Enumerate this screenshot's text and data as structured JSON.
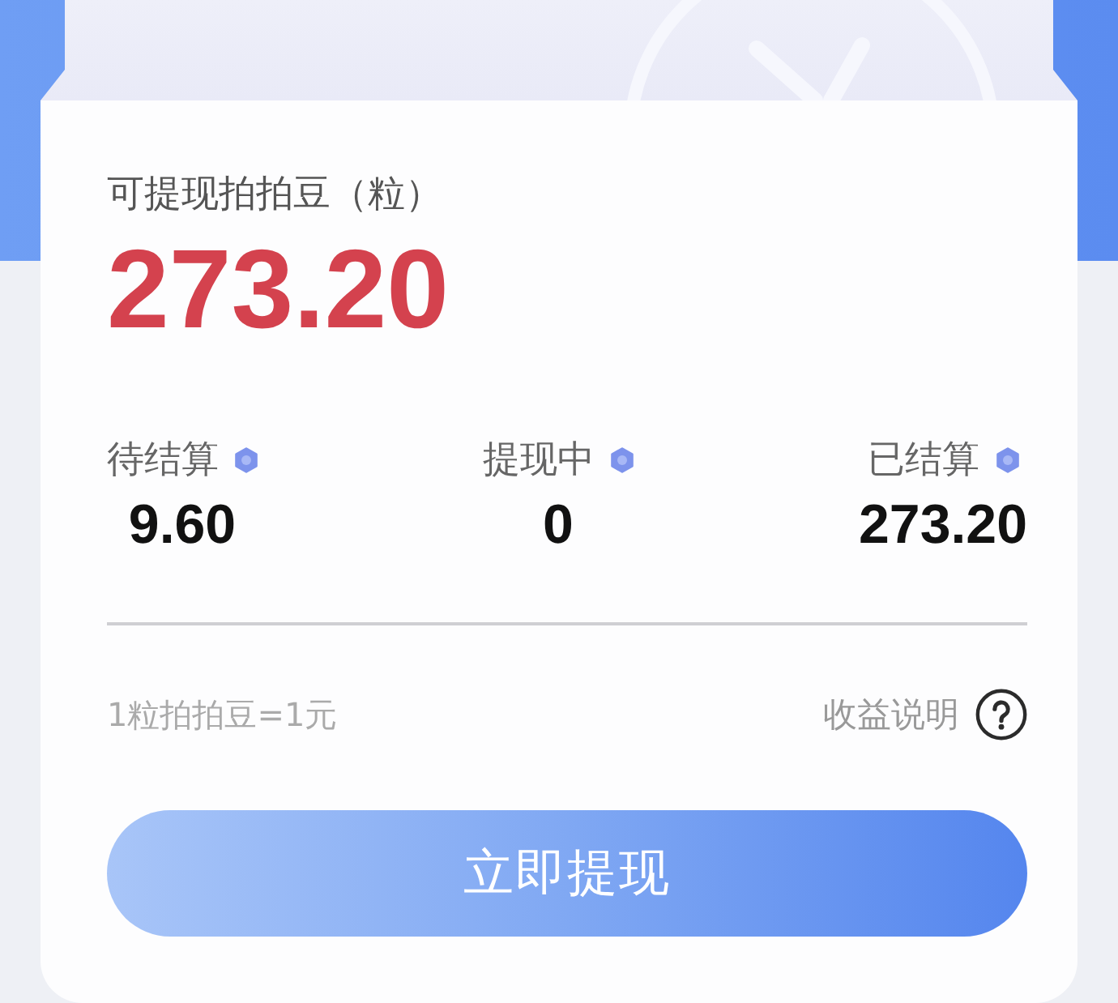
{
  "balance": {
    "label": "可提现拍拍豆（粒）",
    "value": "273.20"
  },
  "stats": [
    {
      "label": "待结算",
      "value": "9.60"
    },
    {
      "label": "提现中",
      "value": "0"
    },
    {
      "label": "已结算",
      "value": "273.20"
    }
  ],
  "footer": {
    "rate": "1粒拍拍豆=1元",
    "help_link": "收益说明"
  },
  "withdraw_button": {
    "label": "立即提现"
  }
}
